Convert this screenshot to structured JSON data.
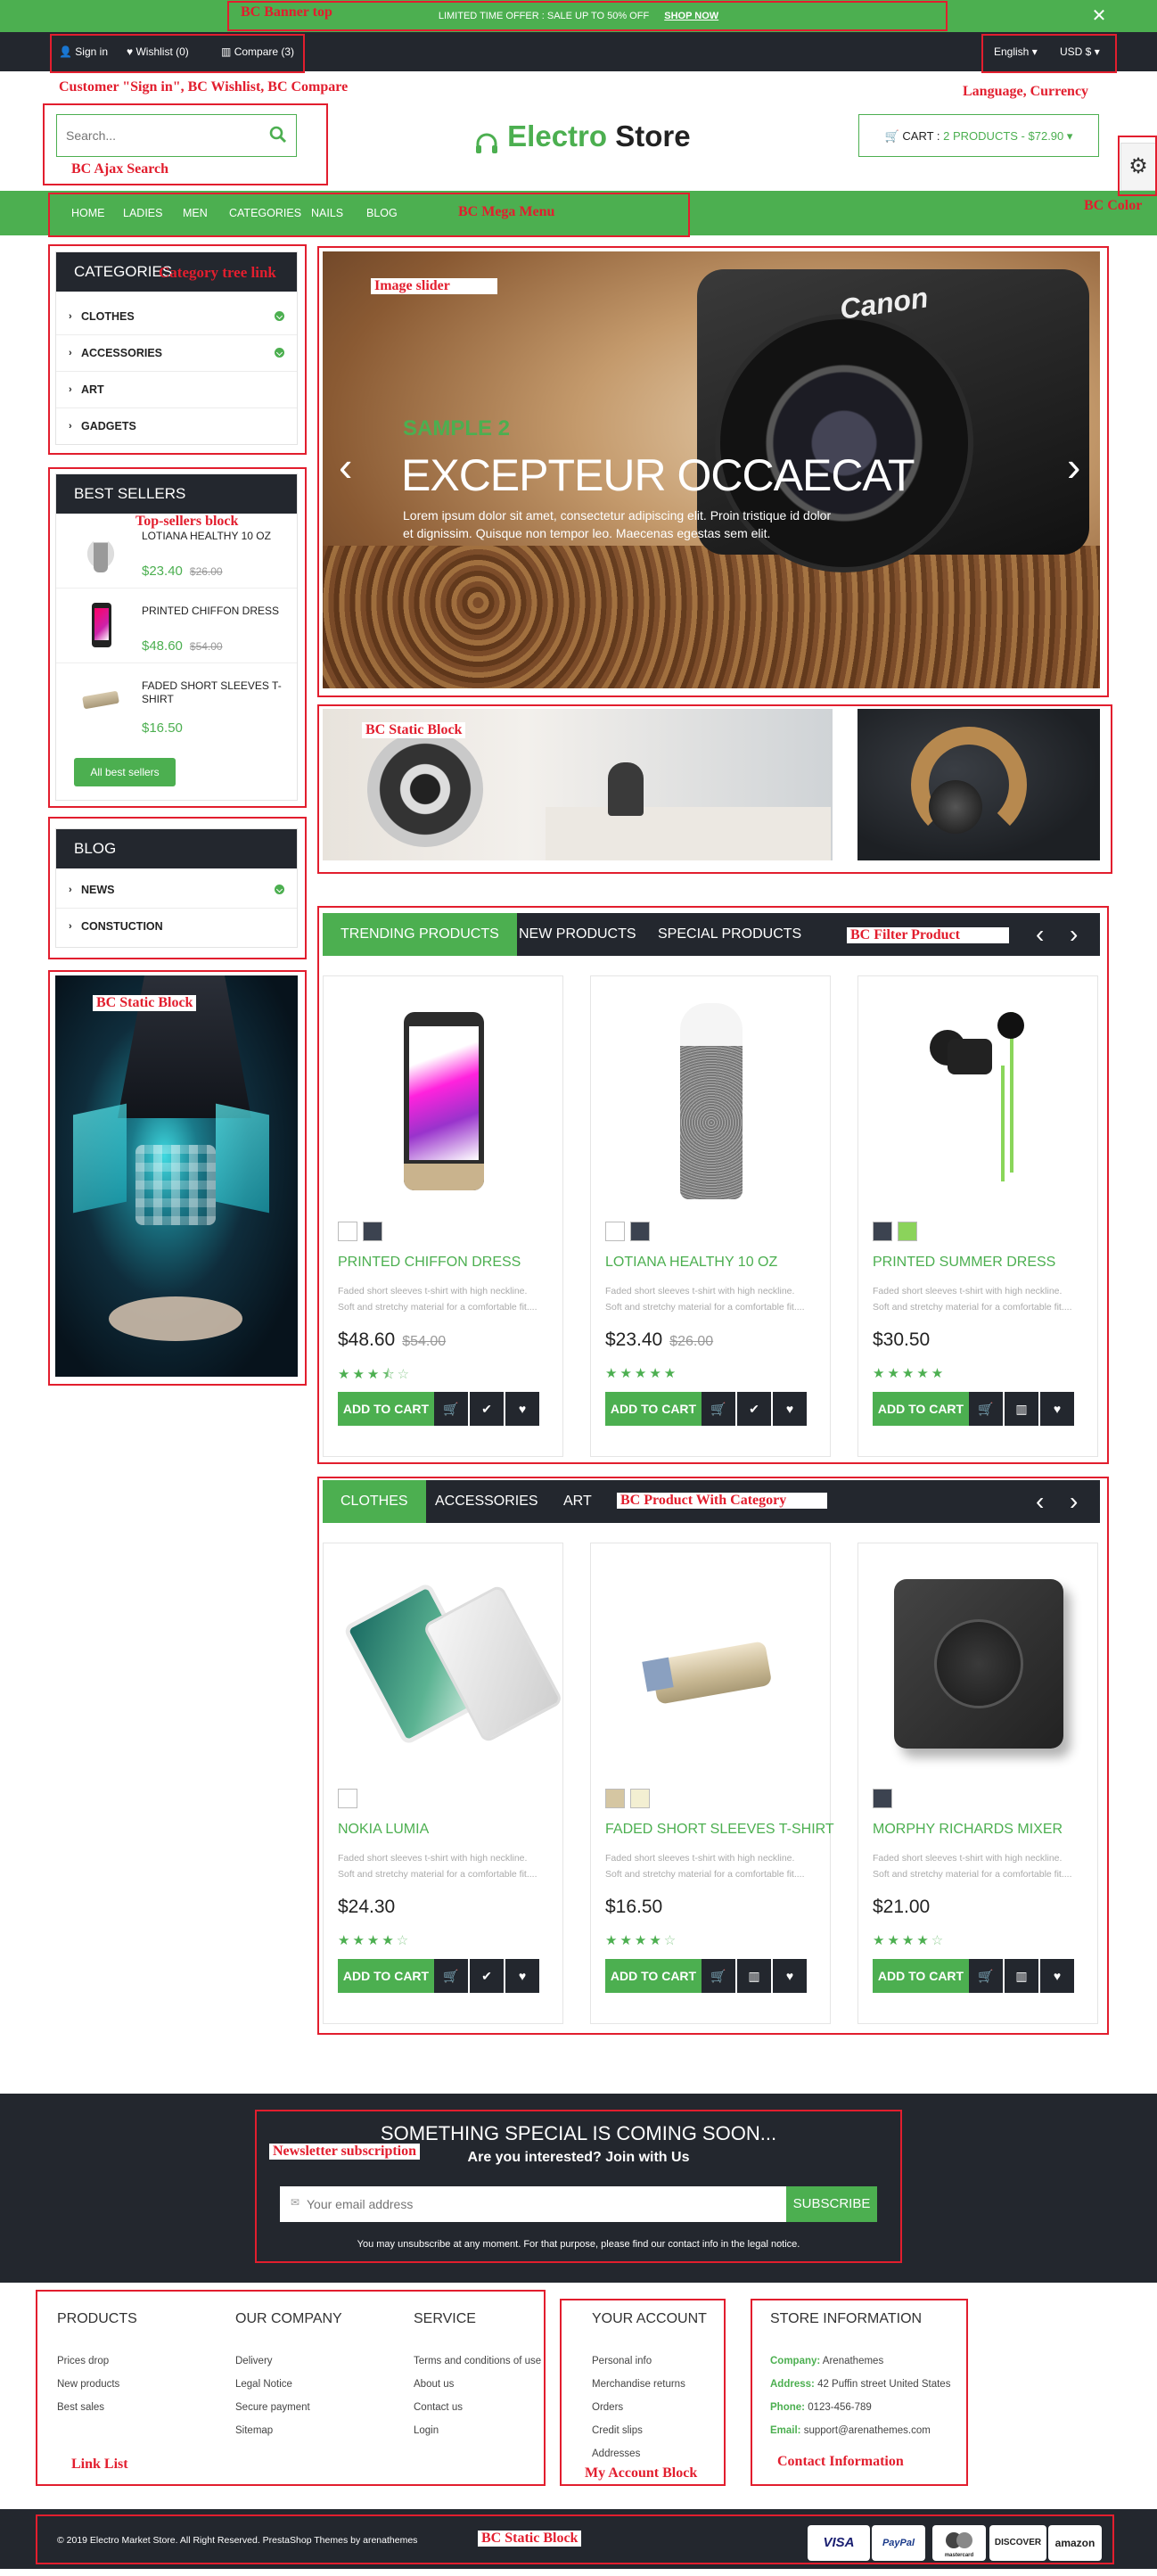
{
  "banner": {
    "offer_text": "LIMITED TIME OFFER : SALE UP TO 50% OFF",
    "shop_now": "SHOP NOW",
    "close": "✕"
  },
  "topbar": {
    "sign_in": "Sign in",
    "wishlist": "Wishlist (0)",
    "compare": "Compare (3)",
    "language": "English",
    "currency": "USD $"
  },
  "header": {
    "search_placeholder": "Search...",
    "logo_part1": "Electro",
    "logo_part2": "Store",
    "cart_prefix": "CART : ",
    "cart_value": "2 PRODUCTS - $72.90"
  },
  "menu": [
    "HOME",
    "LADIES",
    "MEN",
    "CATEGORIES",
    "NAILS",
    "BLOG"
  ],
  "categories": {
    "title": "CATEGORIES",
    "items": [
      "CLOTHES",
      "ACCESSORIES",
      "ART",
      "GADGETS"
    ]
  },
  "best_sellers": {
    "title": "BEST SELLERS",
    "items": [
      {
        "name": "LOTIANA HEALTHY 10 OZ",
        "price": "$23.40",
        "old": "$26.00"
      },
      {
        "name": "PRINTED CHIFFON DRESS",
        "price": "$48.60",
        "old": "$54.00"
      },
      {
        "name": "FADED SHORT SLEEVES T-SHIRT",
        "price": "$16.50",
        "old": ""
      }
    ],
    "button": "All best sellers"
  },
  "blog": {
    "title": "BLOG",
    "items": [
      "NEWS",
      "CONSTUCTION"
    ]
  },
  "slider": {
    "kicker": "SAMPLE 2",
    "heading": "EXCEPTEUR OCCAECAT",
    "text1": "Lorem ipsum dolor sit amet, consectetur adipiscing elit. Proin tristique id dolor",
    "text2": "et dignissim. Quisque non tempor leo. Maecenas egestas sem elit.",
    "prev": "‹",
    "next": "›",
    "brand": "Canon"
  },
  "filter_tabs": [
    "TRENDING PRODUCTS",
    "NEW PRODUCTS",
    "SPECIAL PRODUCTS"
  ],
  "category_tabs": [
    "CLOTHES",
    "ACCESSORIES",
    "ART"
  ],
  "desc_line1": "Faded short sleeves t-shirt with high neckline.",
  "desc_line2": "Soft and stretchy material for a comfortable fit....",
  "add_to_cart": "ADD TO CART",
  "products_row1": [
    {
      "name": "PRINTED CHIFFON DRESS",
      "price": "$48.60",
      "old": "$54.00",
      "rating": 3.5
    },
    {
      "name": "LOTIANA HEALTHY 10 OZ",
      "price": "$23.40",
      "old": "$26.00",
      "rating": 5
    },
    {
      "name": "PRINTED SUMMER DRESS",
      "price": "$30.50",
      "old": "",
      "rating": 5
    }
  ],
  "products_row2": [
    {
      "name": "NOKIA LUMIA",
      "price": "$24.30",
      "old": "",
      "rating": 4
    },
    {
      "name": "FADED SHORT SLEEVES T-SHIRT",
      "price": "$16.50",
      "old": "",
      "rating": 4
    },
    {
      "name": "MORPHY RICHARDS MIXER",
      "price": "$21.00",
      "old": "",
      "rating": 4
    }
  ],
  "newsletter": {
    "title": "SOMETHING SPECIAL IS COMING SOON...",
    "subtitle": "Are you interested? Join with Us",
    "placeholder": "Your email address",
    "button": "SUBSCRIBE",
    "note": "You may unsubscribe at any moment. For that purpose, please find our contact info in the legal notice."
  },
  "footer": {
    "products": {
      "title": "PRODUCTS",
      "links": [
        "Prices drop",
        "New products",
        "Best sales"
      ]
    },
    "company": {
      "title": "OUR COMPANY",
      "links": [
        "Delivery",
        "Legal Notice",
        "Secure payment",
        "Sitemap"
      ]
    },
    "service": {
      "title": "SERVICE",
      "links": [
        "Terms and conditions of use",
        "About us",
        "Contact us",
        "Login"
      ]
    },
    "account": {
      "title": "YOUR ACCOUNT",
      "links": [
        "Personal info",
        "Merchandise returns",
        "Orders",
        "Credit slips",
        "Addresses"
      ]
    },
    "store": {
      "title": "STORE INFORMATION",
      "company_label": "Company:",
      "company": "Arenathemes",
      "address_label": "Address:",
      "address": "42 Puffin street United States",
      "phone_label": "Phone:",
      "phone": "0123-456-789",
      "email_label": "Email:",
      "email": "support@arenathemes.com"
    }
  },
  "copyright": "© 2019 Electro Market Store. All Right Reserved. PrestaShop Themes by arenathemes",
  "payments": [
    "VISA",
    "PayPal",
    "mastercard",
    "DISCOVER",
    "amazon"
  ],
  "annotations": {
    "banner_top": "BC Banner top",
    "customer": "Customer \"Sign in\", BC Wishlist, BC Compare",
    "language": "Language, Currency",
    "ajax_search": "BC Ajax Search",
    "mega_menu": "BC Mega Menu",
    "color": "BC Color",
    "category_tree": "Category tree link",
    "top_sellers": "Top-sellers block",
    "static_block": "BC Static Block",
    "image_slider": "Image slider",
    "filter_product": "BC Filter Product",
    "product_with_category": "BC Product With Category",
    "newsletter": "Newsletter subscription",
    "link_list": "Link List",
    "my_account": "My Account Block",
    "contact_info": "Contact Information"
  },
  "colors": {
    "accent": "#4caf50",
    "dark": "#23272e",
    "annotation": "#e21e2e"
  }
}
